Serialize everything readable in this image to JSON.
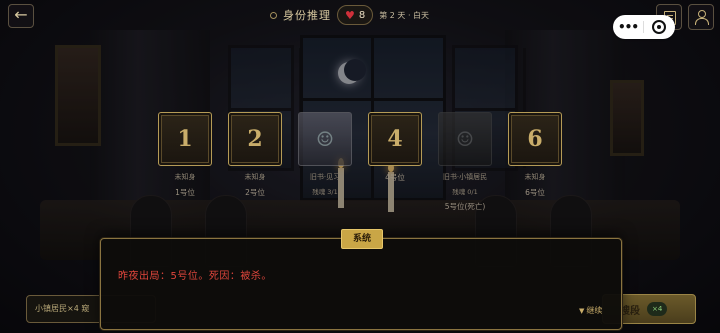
{
  "header": {
    "back_icon": "←",
    "title": "身份推理",
    "hearts_count": "8",
    "day_info": "第 2 天 · 白天"
  },
  "mini_program_capsule": {
    "more_icon": "•••",
    "target_icon": "target-icon"
  },
  "seats": [
    {
      "card": "1",
      "name": "未知身",
      "sub": "",
      "number": "1号位",
      "dead": false
    },
    {
      "card": "2",
      "name": "未知身",
      "sub": "",
      "number": "2号位",
      "dead": false
    },
    {
      "card": "",
      "name": "旧书·见习",
      "sub": "残魂 3/1",
      "number": "",
      "dead": false,
      "avatar": true
    },
    {
      "card": "4",
      "name": "",
      "sub": "",
      "number": "4号位",
      "dead": false
    },
    {
      "card": "",
      "name": "旧书·小镇居民",
      "sub": "残魂 0/1",
      "number": "5号位(死亡)",
      "dead": true,
      "avatar": true
    },
    {
      "card": "6",
      "name": "未知身",
      "sub": "",
      "number": "6号位",
      "dead": false
    }
  ],
  "bottom_strip": {
    "text": "小镇居民×4    窥"
  },
  "action_button": {
    "label": "搜段",
    "cost": "×4"
  },
  "dialog": {
    "tag": "系统",
    "message": "昨夜出局：5号位。死因：被杀。",
    "continue_label": "继续",
    "continue_icon": "▼"
  },
  "colors": {
    "accent_gold": "#c9a646",
    "alert_red": "#e0463c",
    "heart_red": "#d0303a"
  }
}
